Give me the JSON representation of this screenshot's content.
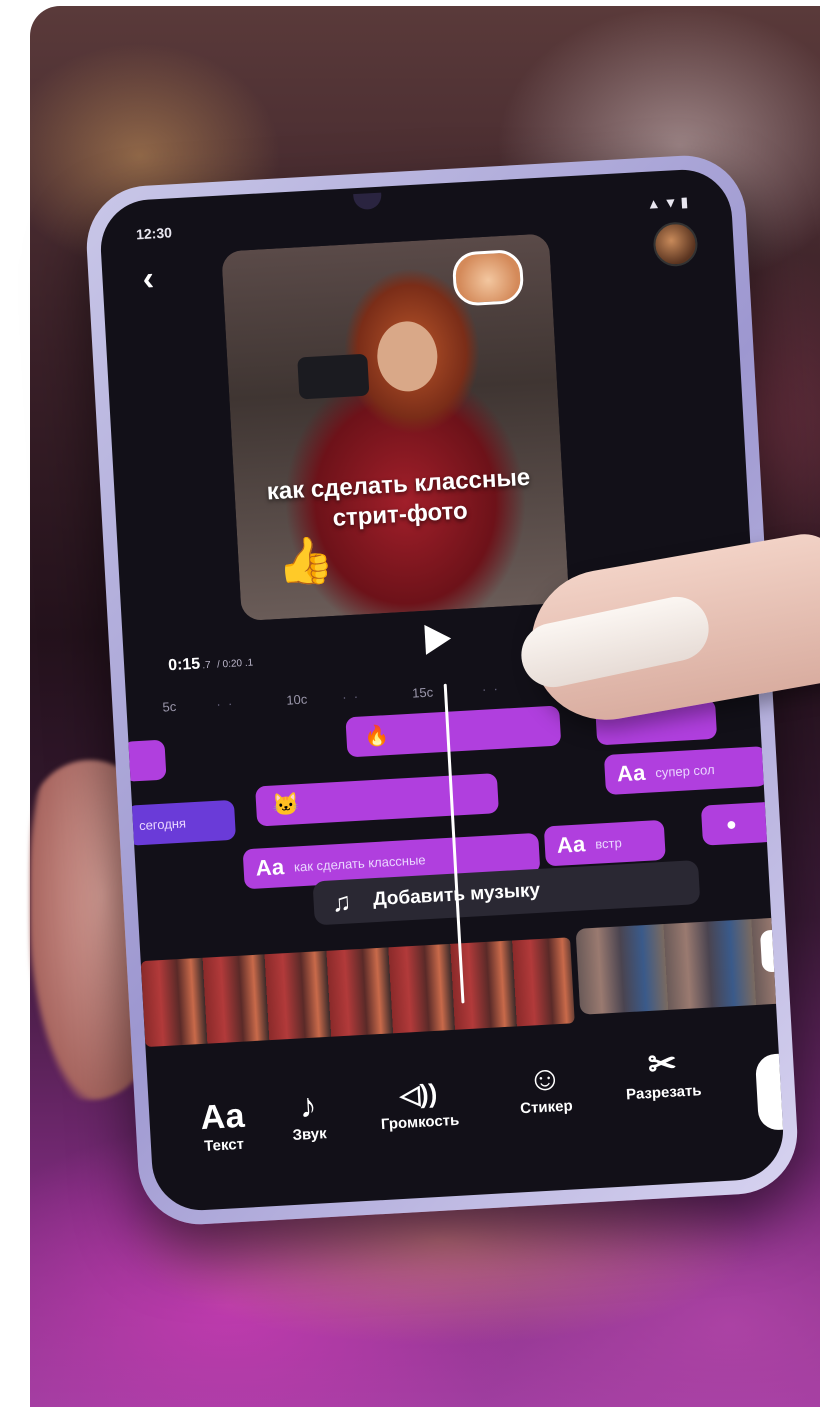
{
  "status": {
    "time": "12:30",
    "icons": "▲▼▮"
  },
  "preview": {
    "caption_line1": "как сделать классные",
    "caption_line2": "стрит-фото"
  },
  "playback": {
    "current": "0:15",
    "current_frac": ".7",
    "total": "/ 0:20 .1"
  },
  "ruler": [
    "5c",
    "10c",
    "15c"
  ],
  "tracks": {
    "text_chips": [
      {
        "label": "Аа",
        "text": "как сделать классные"
      },
      {
        "label": "Аа",
        "text": "встр"
      },
      {
        "label": "Аа",
        "text": "супер сол"
      }
    ],
    "other_chip_text": "сегодня",
    "add_music": "Добавить музыку"
  },
  "toolbar": [
    {
      "icon": "Аа",
      "label": "Текст"
    },
    {
      "icon": "♪",
      "label": "Звук"
    },
    {
      "icon": "◁))",
      "label": "Громкость"
    },
    {
      "icon": "☺",
      "label": "Стикер"
    },
    {
      "icon": "✂",
      "label": "Разрезать"
    }
  ],
  "colors": {
    "accent": "#b03fde",
    "accent_blue": "#6a3bd8",
    "screen": "#121018"
  }
}
